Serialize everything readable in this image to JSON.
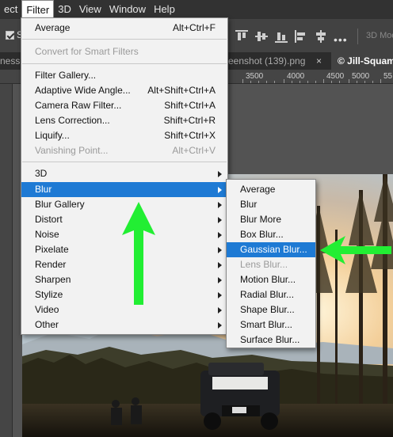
{
  "menubar": [
    "ect",
    "Filter",
    "3D",
    "View",
    "Window",
    "Help"
  ],
  "options": {
    "checkbox_label": "S",
    "more": "•••",
    "mode_3d": "3D Mod"
  },
  "tabs": {
    "left_partial": "ness",
    "screenshot": "eenshot (139).png",
    "close": "×",
    "active": "© Jill-Squam"
  },
  "ruler": [
    "3500",
    "4000",
    "4500",
    "5000",
    "55"
  ],
  "filter_menu": {
    "items": [
      {
        "label": "Average",
        "shortcut": "Alt+Ctrl+F"
      },
      {
        "label": "Convert for Smart Filters",
        "disabled": true
      },
      {
        "label": "Filter Gallery..."
      },
      {
        "label": "Adaptive Wide Angle...",
        "shortcut": "Alt+Shift+Ctrl+A"
      },
      {
        "label": "Camera Raw Filter...",
        "shortcut": "Shift+Ctrl+A"
      },
      {
        "label": "Lens Correction...",
        "shortcut": "Shift+Ctrl+R"
      },
      {
        "label": "Liquify...",
        "shortcut": "Shift+Ctrl+X"
      },
      {
        "label": "Vanishing Point...",
        "shortcut": "Alt+Ctrl+V",
        "disabled": true
      },
      {
        "label": "3D",
        "submenu": true
      },
      {
        "label": "Blur",
        "submenu": true,
        "highlighted": true
      },
      {
        "label": "Blur Gallery",
        "submenu": true
      },
      {
        "label": "Distort",
        "submenu": true
      },
      {
        "label": "Noise",
        "submenu": true
      },
      {
        "label": "Pixelate",
        "submenu": true
      },
      {
        "label": "Render",
        "submenu": true
      },
      {
        "label": "Sharpen",
        "submenu": true
      },
      {
        "label": "Stylize",
        "submenu": true
      },
      {
        "label": "Video",
        "submenu": true
      },
      {
        "label": "Other",
        "submenu": true
      }
    ]
  },
  "blur_submenu": {
    "items": [
      {
        "label": "Average"
      },
      {
        "label": "Blur"
      },
      {
        "label": "Blur More"
      },
      {
        "label": "Box Blur..."
      },
      {
        "label": "Gaussian Blur...",
        "highlighted": true
      },
      {
        "label": "Lens Blur...",
        "disabled": true
      },
      {
        "label": "Motion Blur..."
      },
      {
        "label": "Radial Blur..."
      },
      {
        "label": "Shape Blur..."
      },
      {
        "label": "Smart Blur..."
      },
      {
        "label": "Surface Blur..."
      }
    ]
  },
  "colors": {
    "highlight": "#1e7ad4",
    "annotation_arrow": "#22ee33"
  }
}
